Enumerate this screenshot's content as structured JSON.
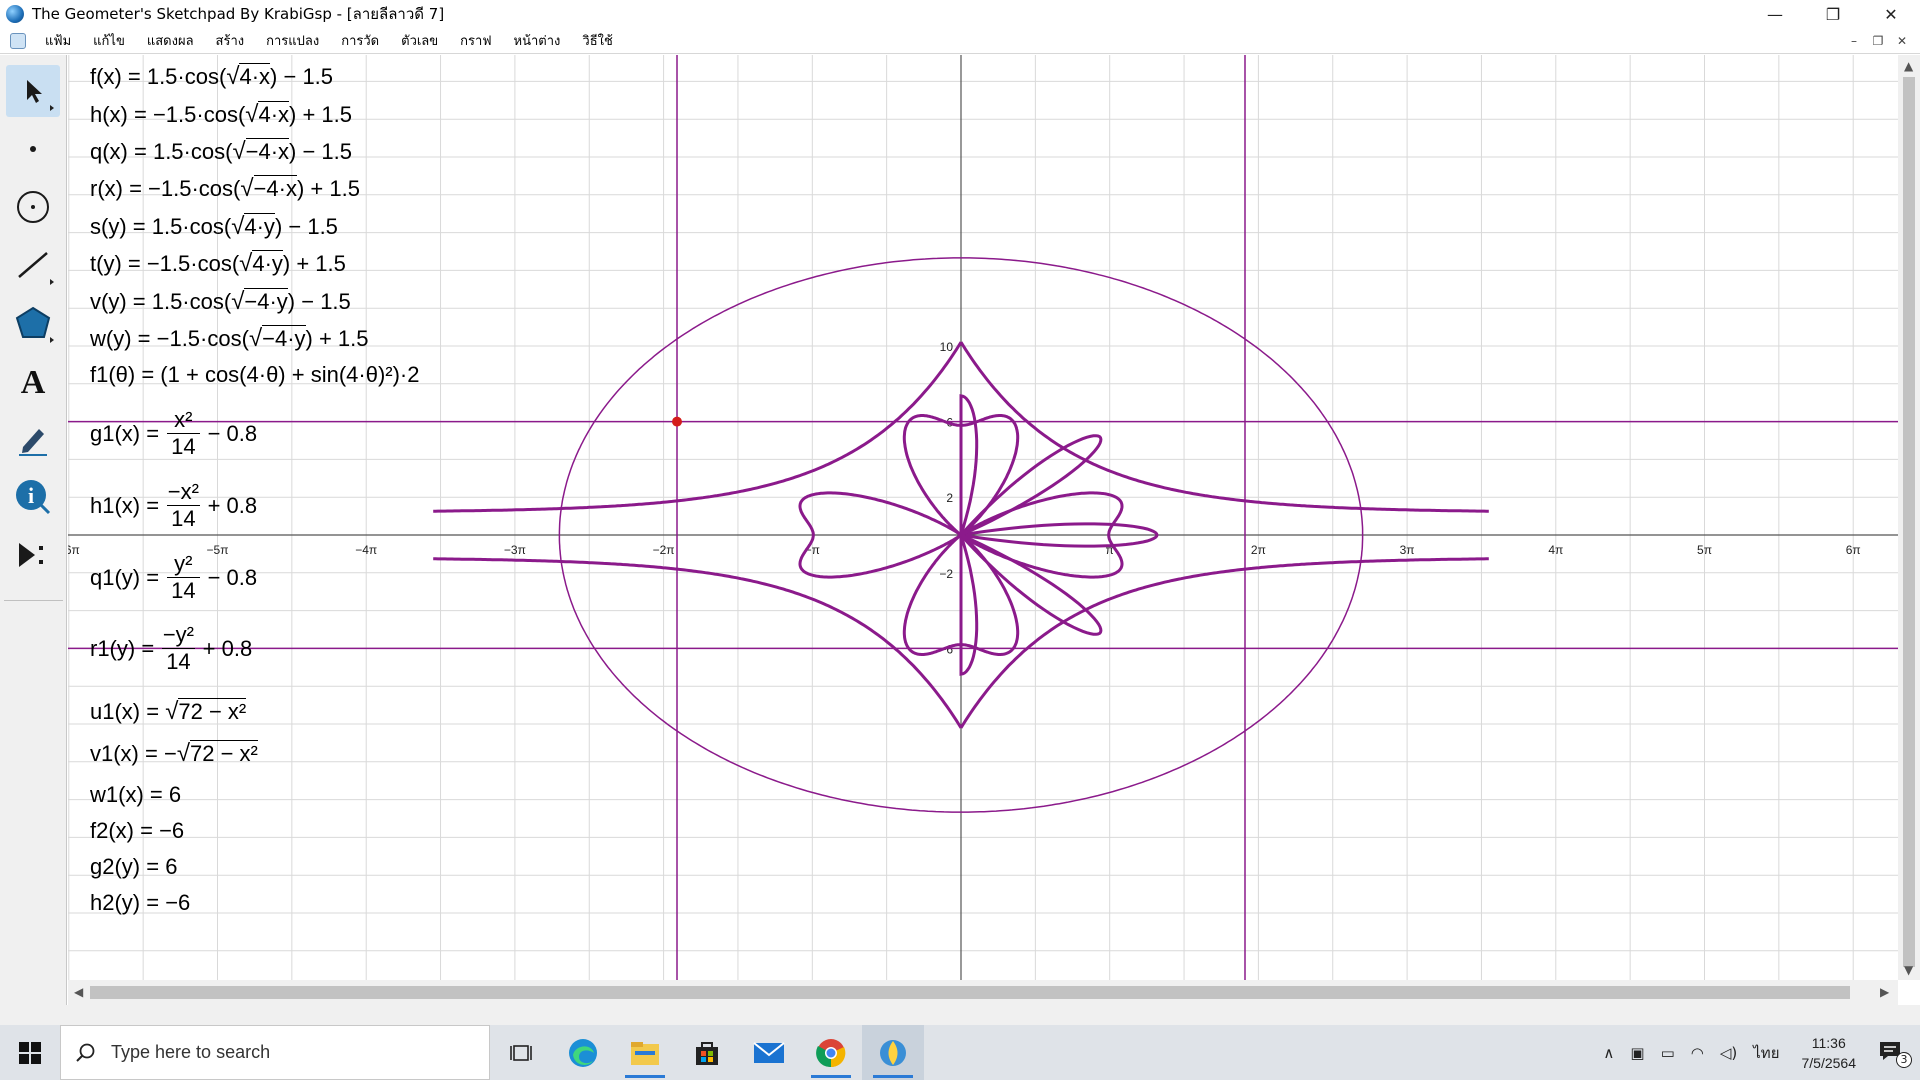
{
  "window": {
    "title": "The Geometer's Sketchpad By KrabiGsp - [ลายลีลาวดี 7]",
    "minimize_glyph": "—",
    "maximize_glyph": "❐",
    "close_glyph": "✕"
  },
  "menu": {
    "items": [
      "แฟ้ม",
      "แก้ไข",
      "แสดงผล",
      "สร้าง",
      "การแปลง",
      "การวัด",
      "ตัวเลข",
      "กราฟ",
      "หน้าต่าง",
      "วิธีใช้"
    ],
    "doc_controls": [
      "–",
      "❐",
      "✕"
    ]
  },
  "toolbox": {
    "tools": [
      {
        "name": "arrow-tool",
        "icon": "arrow-select-icon",
        "active": true
      },
      {
        "name": "point-tool",
        "icon": "point-icon",
        "active": false
      },
      {
        "name": "compass-tool",
        "icon": "circle-icon",
        "active": false
      },
      {
        "name": "straightedge-tool",
        "icon": "segment-icon",
        "active": false
      },
      {
        "name": "polygon-tool",
        "icon": "polygon-icon",
        "active": false
      },
      {
        "name": "text-tool",
        "icon": "text-A-icon",
        "active": false
      },
      {
        "name": "marker-tool",
        "icon": "marker-icon",
        "active": false
      },
      {
        "name": "information-tool",
        "icon": "info-icon",
        "active": false
      },
      {
        "name": "custom-tool",
        "icon": "custom-tool-icon",
        "active": false
      }
    ]
  },
  "formulas": {
    "f": {
      "name": "f",
      "arg": "x",
      "lhs": "f(x) = 1.5·cos(",
      "rad": "4·x",
      "rhs": ") − 1.5"
    },
    "h": {
      "lhs": "h(x) = −1.5·cos(",
      "rad": "4·x",
      "rhs": ") + 1.5"
    },
    "q": {
      "lhs": "q(x) = 1.5·cos(",
      "rad": "−4·x",
      "rhs": ") − 1.5"
    },
    "r": {
      "lhs": "r(x) = −1.5·cos(",
      "rad": "−4·x",
      "rhs": ") + 1.5"
    },
    "s": {
      "lhs": "s(y) = 1.5·cos(",
      "rad": "4·y",
      "rhs": ") − 1.5"
    },
    "t": {
      "lhs": "t(y) = −1.5·cos(",
      "rad": "4·y",
      "rhs": ") + 1.5"
    },
    "v": {
      "lhs": "v(y) = 1.5·cos(",
      "rad": "−4·y",
      "rhs": ") − 1.5"
    },
    "w": {
      "lhs": "w(y) = −1.5·cos(",
      "rad": "−4·y",
      "rhs": ") + 1.5"
    },
    "f1": {
      "text": "f1(θ) = (1 + cos(4·θ) + sin(4·θ)²)·2"
    },
    "g1": {
      "lhs": "g1(x) =",
      "num": "x²",
      "den": "14",
      "rhs": "− 0.8"
    },
    "h1": {
      "lhs": "h1(x) =",
      "num": "−x²",
      "den": "14",
      "rhs": "+ 0.8"
    },
    "q1": {
      "lhs": "q1(y) =",
      "num": "y²",
      "den": "14",
      "rhs": "− 0.8"
    },
    "r1": {
      "lhs": "r1(y) =",
      "num": "−y²",
      "den": "14",
      "rhs": "+ 0.8"
    },
    "u1": {
      "lhs": "u1(x) = ",
      "rad": "72 − x²"
    },
    "v1": {
      "lhs": "v1(x) = −",
      "rad": "72 − x²"
    },
    "w1": {
      "text": "w1(x) = 6"
    },
    "f2": {
      "text": "f2(x) = −6"
    },
    "g2": {
      "text": "g2(y) = 6"
    },
    "h2": {
      "text": "h2(y) = −6"
    }
  },
  "graph": {
    "x_tick_labels": [
      "−6π",
      "−5π",
      "−4π",
      "−3π",
      "−2π",
      "−π",
      "π",
      "2π",
      "3π",
      "4π",
      "5π",
      "6π"
    ],
    "y_tick_labels": [
      "10",
      "6",
      "2",
      "−2",
      "−6"
    ],
    "curve_color": "#8b1a8b",
    "grid_color": "#d9d9d9",
    "point_color": "#d41c1c"
  },
  "taskbar": {
    "search_placeholder": "Type here to search",
    "apps": [
      "task-view-icon",
      "edge-icon",
      "file-explorer-icon",
      "store-icon",
      "mail-icon",
      "chrome-icon",
      "sketchpad-icon"
    ],
    "language": "ไทย",
    "time": "11:36",
    "date": "7/5/2564",
    "notification_count": "3"
  }
}
